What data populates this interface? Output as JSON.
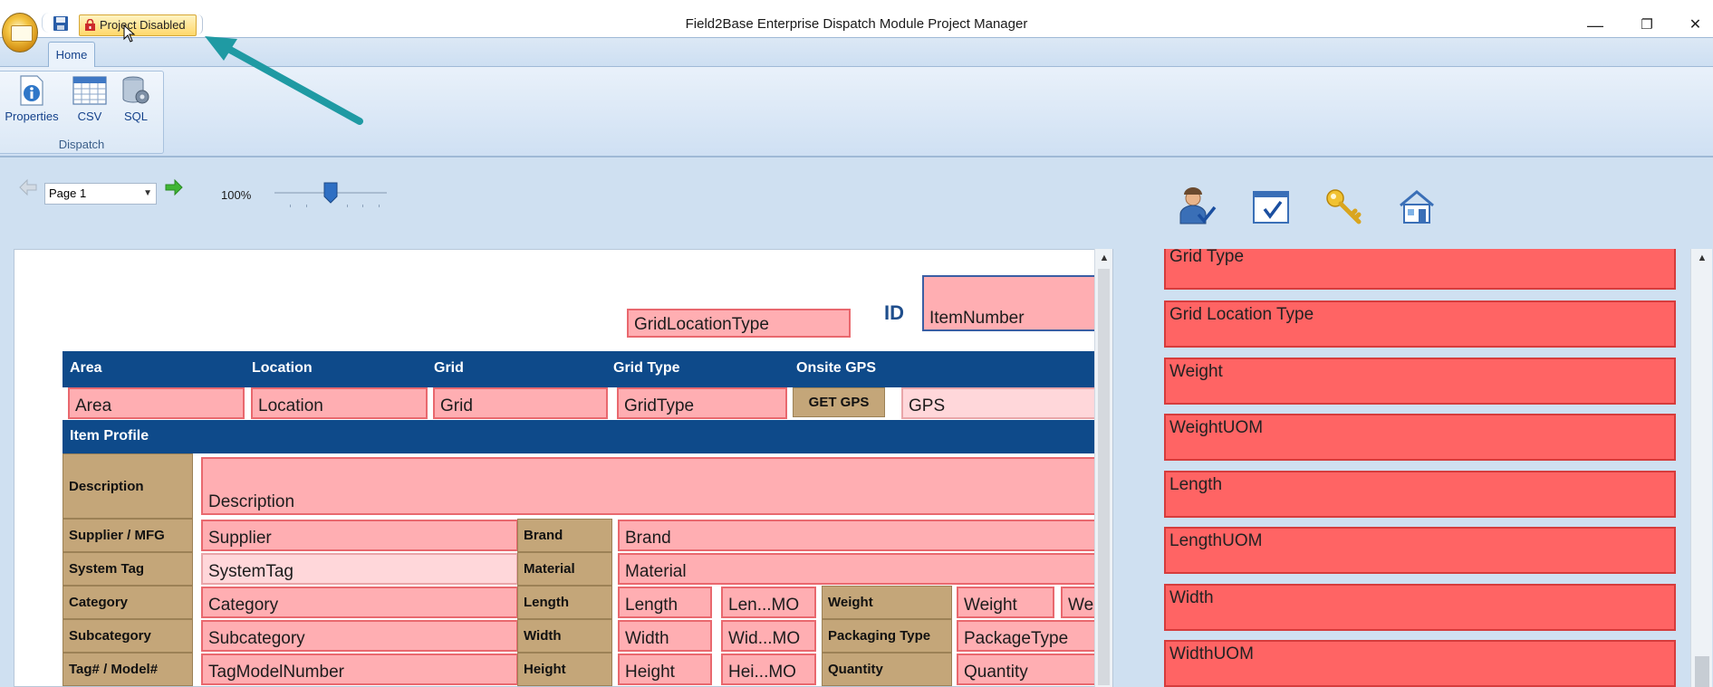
{
  "window": {
    "title": "Field2Base Enterprise Dispatch Module Project Manager",
    "minimize": "—",
    "restore": "❐",
    "close": "✕"
  },
  "qat": {
    "project_button_label": "Project Disabled"
  },
  "ribbon": {
    "tabs": [
      {
        "label": "Home"
      }
    ],
    "group": {
      "label": "Dispatch",
      "buttons": [
        {
          "label": "Properties"
        },
        {
          "label": "CSV"
        },
        {
          "label": "SQL"
        }
      ]
    }
  },
  "navigation": {
    "page_value": "Page 1",
    "zoom": "100%",
    "zoom_slider_fraction": 0.44
  },
  "form": {
    "id_label": "ID",
    "grid_location_type": "GridLocationType",
    "item_number": "ItemNumber",
    "header_row": {
      "area": "Area",
      "location": "Location",
      "grid": "Grid",
      "grid_type": "Grid Type",
      "onsite_gps": "Onsite GPS"
    },
    "values_row": {
      "area": "Area",
      "location": "Location",
      "grid": "Grid",
      "grid_type": "GridType",
      "get_gps": "GET GPS",
      "gps": "GPS"
    },
    "section_title": "Item Profile",
    "labels": {
      "description": "Description",
      "supplier": "Supplier / MFG",
      "system_tag": "System Tag",
      "category": "Category",
      "subcategory": "Subcategory",
      "tag_model": "Tag# / Model#",
      "brand": "Brand",
      "material": "Material",
      "length": "Length",
      "width": "Width",
      "height": "Height",
      "weight": "Weight",
      "packaging_type": "Packaging Type",
      "quantity": "Quantity"
    },
    "fields": {
      "description": "Description",
      "supplier": "Supplier",
      "system_tag": "SystemTag",
      "category": "Category",
      "subcategory": "Subcategory",
      "tag_model": "TagModelNumber",
      "brand": "Brand",
      "material": "Material",
      "length": "Length",
      "length_uom": "Len...MO",
      "width": "Width",
      "width_uom": "Wid...MO",
      "height": "Height",
      "height_uom": "Hei...MO",
      "weight": "Weight",
      "weight_uom": "We",
      "packaging_type": "PackageType",
      "quantity": "Quantity"
    }
  },
  "field_list": [
    "Grid Type",
    "Grid Location Type",
    "Weight",
    "WeightUOM",
    "Length",
    "LengthUOM",
    "Width",
    "WidthUOM"
  ],
  "colors": {
    "header_blue": "#0e4a8a",
    "field_pink": "#ffaeb2",
    "field_red": "#ff6464",
    "label_tan": "#c4a679",
    "annotation_arrow": "#1f9aa3"
  }
}
